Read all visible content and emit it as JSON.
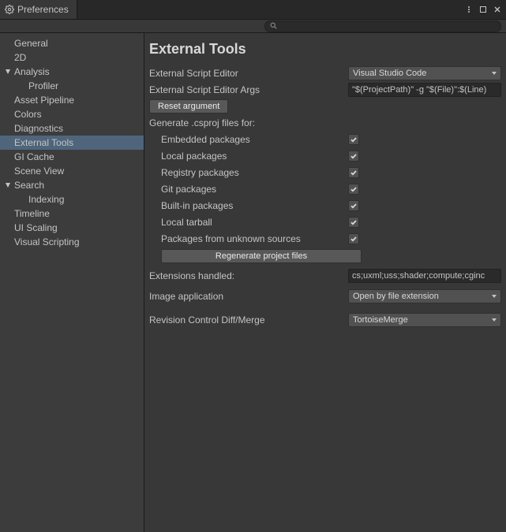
{
  "window": {
    "title": "Preferences"
  },
  "search": {
    "placeholder": ""
  },
  "sidebar": {
    "items": [
      {
        "label": "General",
        "type": "item"
      },
      {
        "label": "2D",
        "type": "item"
      },
      {
        "label": "Analysis",
        "type": "fold",
        "expanded": true
      },
      {
        "label": "Profiler",
        "type": "child"
      },
      {
        "label": "Asset Pipeline",
        "type": "item"
      },
      {
        "label": "Colors",
        "type": "item"
      },
      {
        "label": "Diagnostics",
        "type": "item"
      },
      {
        "label": "External Tools",
        "type": "item",
        "selected": true
      },
      {
        "label": "GI Cache",
        "type": "item"
      },
      {
        "label": "Scene View",
        "type": "item"
      },
      {
        "label": "Search",
        "type": "fold",
        "expanded": true
      },
      {
        "label": "Indexing",
        "type": "child"
      },
      {
        "label": "Timeline",
        "type": "item"
      },
      {
        "label": "UI Scaling",
        "type": "item"
      },
      {
        "label": "Visual Scripting",
        "type": "item"
      }
    ]
  },
  "main": {
    "title": "External Tools",
    "scriptEditor": {
      "label": "External Script Editor",
      "value": "Visual Studio Code"
    },
    "scriptEditorArgs": {
      "label": "External Script Editor Args",
      "value": "\"$(ProjectPath)\" -g \"$(File)\":$(Line)"
    },
    "resetBtn": "Reset argument",
    "csprojHeader": "Generate .csproj files for:",
    "csproj": [
      {
        "label": "Embedded packages",
        "checked": true
      },
      {
        "label": "Local packages",
        "checked": true
      },
      {
        "label": "Registry packages",
        "checked": true
      },
      {
        "label": "Git packages",
        "checked": true
      },
      {
        "label": "Built-in packages",
        "checked": true
      },
      {
        "label": "Local tarball",
        "checked": true
      },
      {
        "label": "Packages from unknown sources",
        "checked": true
      }
    ],
    "regenBtn": "Regenerate project files",
    "extensions": {
      "label": "Extensions handled:",
      "value": "cs;uxml;uss;shader;compute;cginc"
    },
    "imageApp": {
      "label": "Image application",
      "value": "Open by file extension"
    },
    "diffMerge": {
      "label": "Revision Control Diff/Merge",
      "value": "TortoiseMerge"
    }
  }
}
